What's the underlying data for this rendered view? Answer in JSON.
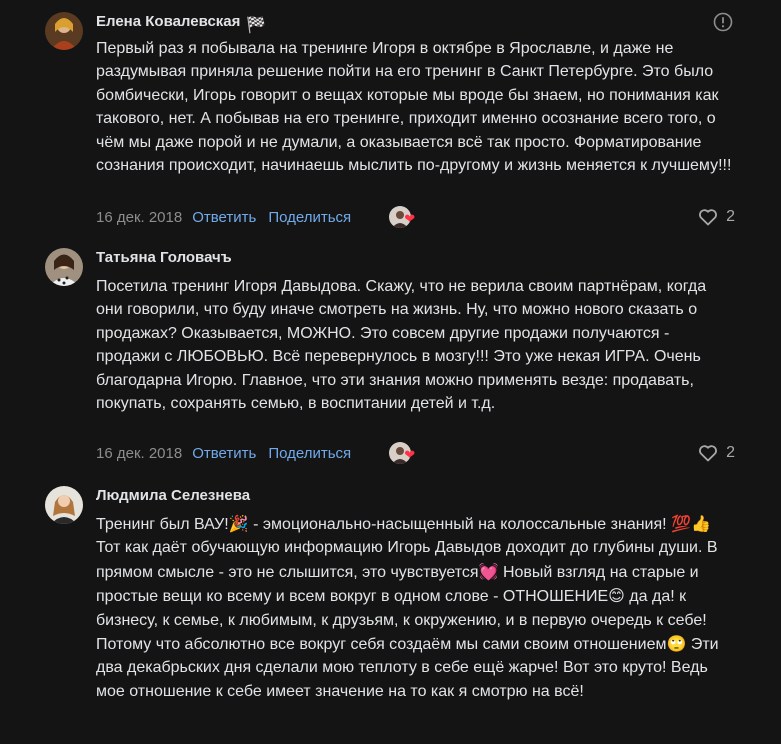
{
  "comments": [
    {
      "author": "Елена Ковалевская",
      "author_emoji": "🏁",
      "text": "Первый раз я побывала на тренинге Игоря в октябре в Ярославле, и даже не раздумывая приняла решение пойти на его тренинг в Санкт Петербурге. Это было бомбически, Игорь говорит о вещах которые мы вроде бы знаем, но понимания как такового, нет. А побывав на его тренинге, приходит именно осознание всего того, о чём мы даже порой и не думали, а оказывается всё так просто. Форматирование сознания происходит, начинаешь мыслить по-другому и жизнь меняется к лучшему!!!",
      "date": "16 дек. 2018",
      "reply_label": "Ответить",
      "share_label": "Поделиться",
      "likes": "2"
    },
    {
      "author": "Татьяна Головачъ",
      "text": "Посетила тренинг Игоря Давыдова. Скажу, что не верила своим партнёрам, когда они говорили, что буду иначе смотреть на жизнь. Ну, что можно нового сказать о продажах? Оказывается, МОЖНО. Это совсем другие продажи получаются - продажи с ЛЮБОВЬЮ. Всё перевернулось в мозгу!!! Это уже некая ИГРА. Очень благодарна Игорю. Главное, что эти знания можно применять везде: продавать, покупать, сохранять семью, в воспитании детей и т.д.",
      "date": "16 дек. 2018",
      "reply_label": "Ответить",
      "share_label": "Поделиться",
      "likes": "2"
    },
    {
      "author": "Людмила Селезнева",
      "text_parts": [
        "Тренинг был ВАУ!",
        "🎉",
        " - эмоционально-насыщенный на колоссальные знания! ",
        "💯👍",
        " Тот как даёт обучающую информацию Игорь Давыдов доходит до глубины души. В прямом смысле - это не слышится, это чувствуется",
        "💓",
        " Новый взгляд на старые и простые вещи ко всему и всем вокруг в одном слове - ОТНОШЕНИЕ",
        "😊",
        " да да! к бизнесу, к семье, к любимым, к друзьям, к окружению, и в первую очередь к себе! Потому что абсолютно все вокруг себя создаём мы сами своим отношением",
        "🙄",
        " Эти два декабрьских дня сделали мою теплоту в себе ещё жарче! Вот это круто! Ведь мое отношение к себе имеет значение на то как я смотрю на всё!"
      ]
    }
  ],
  "icons": {
    "more": "more-icon",
    "like": "heart-outline-icon",
    "reaction": "heart-icon"
  },
  "colors": {
    "background": "#141414",
    "text": "#e1e3e6",
    "link": "#71aaeb",
    "muted": "#8d8d8d",
    "heart": "#ff3347"
  }
}
